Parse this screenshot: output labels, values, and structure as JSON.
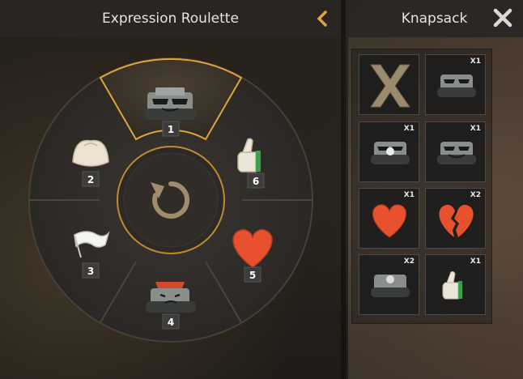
{
  "roulette": {
    "title": "Expression Roulette",
    "slots": [
      {
        "number": "1",
        "icon": "tank-sunglasses-icon"
      },
      {
        "number": "2",
        "icon": "dumpling-icon"
      },
      {
        "number": "3",
        "icon": "white-flag-icon"
      },
      {
        "number": "4",
        "icon": "tank-red-hair-icon"
      },
      {
        "number": "5",
        "icon": "heart-icon"
      },
      {
        "number": "6",
        "icon": "thumbs-up-icon"
      }
    ],
    "center_icon": "refresh-icon",
    "selected_slot": "1",
    "accent_color": "#e0a43a"
  },
  "knapsack": {
    "title": "Knapsack",
    "items": [
      {
        "icon": "remove-x-icon",
        "qty": ""
      },
      {
        "icon": "tank-sunglasses-icon",
        "qty": "X1"
      },
      {
        "icon": "tank-sunglasses-icon",
        "qty": "X1"
      },
      {
        "icon": "tank-grin-icon",
        "qty": "X1"
      },
      {
        "icon": "heart-icon",
        "qty": "X1"
      },
      {
        "icon": "broken-heart-icon",
        "qty": "X2"
      },
      {
        "icon": "tank-plain-icon",
        "qty": "X2"
      },
      {
        "icon": "thumbs-up-icon",
        "qty": "X1"
      }
    ]
  }
}
